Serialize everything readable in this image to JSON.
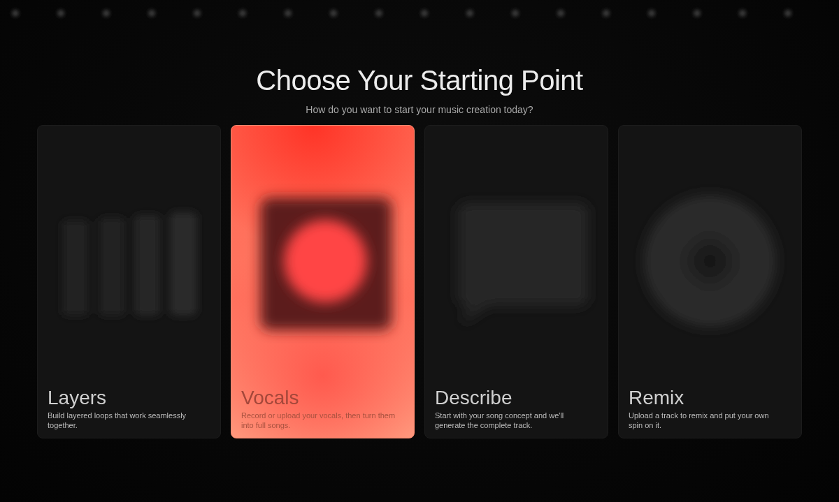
{
  "heading": {
    "title": "Choose Your Starting Point",
    "subtitle": "How do you want to start your music creation today?"
  },
  "cards": [
    {
      "kind": "layers",
      "title": "Layers",
      "description": "Build layered loops that work seamlessly together.",
      "selected": false
    },
    {
      "kind": "vocals",
      "title": "Vocals",
      "description": "Record or upload your vocals, then turn them into full songs.",
      "selected": true
    },
    {
      "kind": "describe",
      "title": "Describe",
      "description": "Start with your song concept and we'll generate the complete track.",
      "selected": false
    },
    {
      "kind": "remix",
      "title": "Remix",
      "description": "Upload a track to remix and put your own spin on it.",
      "selected": false
    }
  ]
}
